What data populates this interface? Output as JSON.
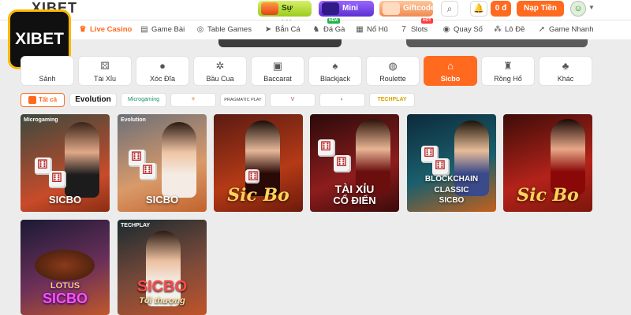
{
  "header": {
    "brand_text": "XIBET",
    "logo_text": "XIBET",
    "promos": [
      {
        "label": "Sự kiện"
      },
      {
        "label": "Mini Game"
      },
      {
        "label": "Giftcode"
      }
    ],
    "balance": "0 đ",
    "deposit_label": "Nạp Tiền"
  },
  "nav": {
    "items": [
      {
        "label": "Live Casino",
        "icon": "casino-icon",
        "active": true
      },
      {
        "label": "Game Bài",
        "icon": "cards-icon"
      },
      {
        "label": "Table Games",
        "icon": "table-icon"
      },
      {
        "label": "Bắn Cá",
        "icon": "fish-icon"
      },
      {
        "label": "Đá Gà",
        "icon": "rooster-icon",
        "badge": "NEW"
      },
      {
        "label": "Nổ Hũ",
        "icon": "jar-icon"
      },
      {
        "label": "Slots",
        "icon": "slots-icon",
        "badge": "HOT"
      },
      {
        "label": "Quay Số",
        "icon": "lottery-icon"
      },
      {
        "label": "Lô Đề",
        "icon": "balls-icon"
      },
      {
        "label": "Game Nhanh",
        "icon": "rocket-icon"
      }
    ]
  },
  "categories": [
    {
      "label": "Sảnh",
      "icon": "lobby-icon"
    },
    {
      "label": "Tài Xỉu",
      "icon": "dice-icon"
    },
    {
      "label": "Xóc Đĩa",
      "icon": "discs-icon"
    },
    {
      "label": "Bầu Cua",
      "icon": "crab-icon"
    },
    {
      "label": "Baccarat",
      "icon": "baccarat-cards-icon"
    },
    {
      "label": "Blackjack",
      "icon": "blackjack-cards-icon"
    },
    {
      "label": "Roulette",
      "icon": "roulette-icon"
    },
    {
      "label": "Sicbo",
      "icon": "sicbo-icon",
      "active": true
    },
    {
      "label": "Rồng Hổ",
      "icon": "dragon-tiger-icon"
    },
    {
      "label": "Khác",
      "icon": "club-icon"
    }
  ],
  "providers": [
    {
      "label": "Tất cả",
      "active": true
    },
    {
      "label": "Evolution"
    },
    {
      "label": "Microgaming"
    },
    {
      "label": ""
    },
    {
      "label": "PRAGMATIC PLAY"
    },
    {
      "label": ""
    },
    {
      "label": ""
    },
    {
      "label": "TECHPLAY"
    }
  ],
  "games": [
    {
      "title": "SICBO",
      "provider": "Microgaming"
    },
    {
      "title": "SICBO",
      "provider": "Evolution"
    },
    {
      "title": "Sic Bo",
      "provider": ""
    },
    {
      "title": "TÀI XỈU",
      "subtitle": "CỔ ĐIỂN",
      "provider": ""
    },
    {
      "title": "BLOCKCHAIN CLASSIC",
      "subtitle": "SICBO",
      "provider": ""
    },
    {
      "title": "Sic Bo",
      "provider": ""
    },
    {
      "title": "LOTUS",
      "subtitle": "SICBO",
      "provider": ""
    },
    {
      "title": "SICBO",
      "subtitle": "Tối thượng",
      "provider": "TECHPLAY"
    }
  ],
  "colors": {
    "accent": "#ff6a1f",
    "background": "#ececec"
  }
}
